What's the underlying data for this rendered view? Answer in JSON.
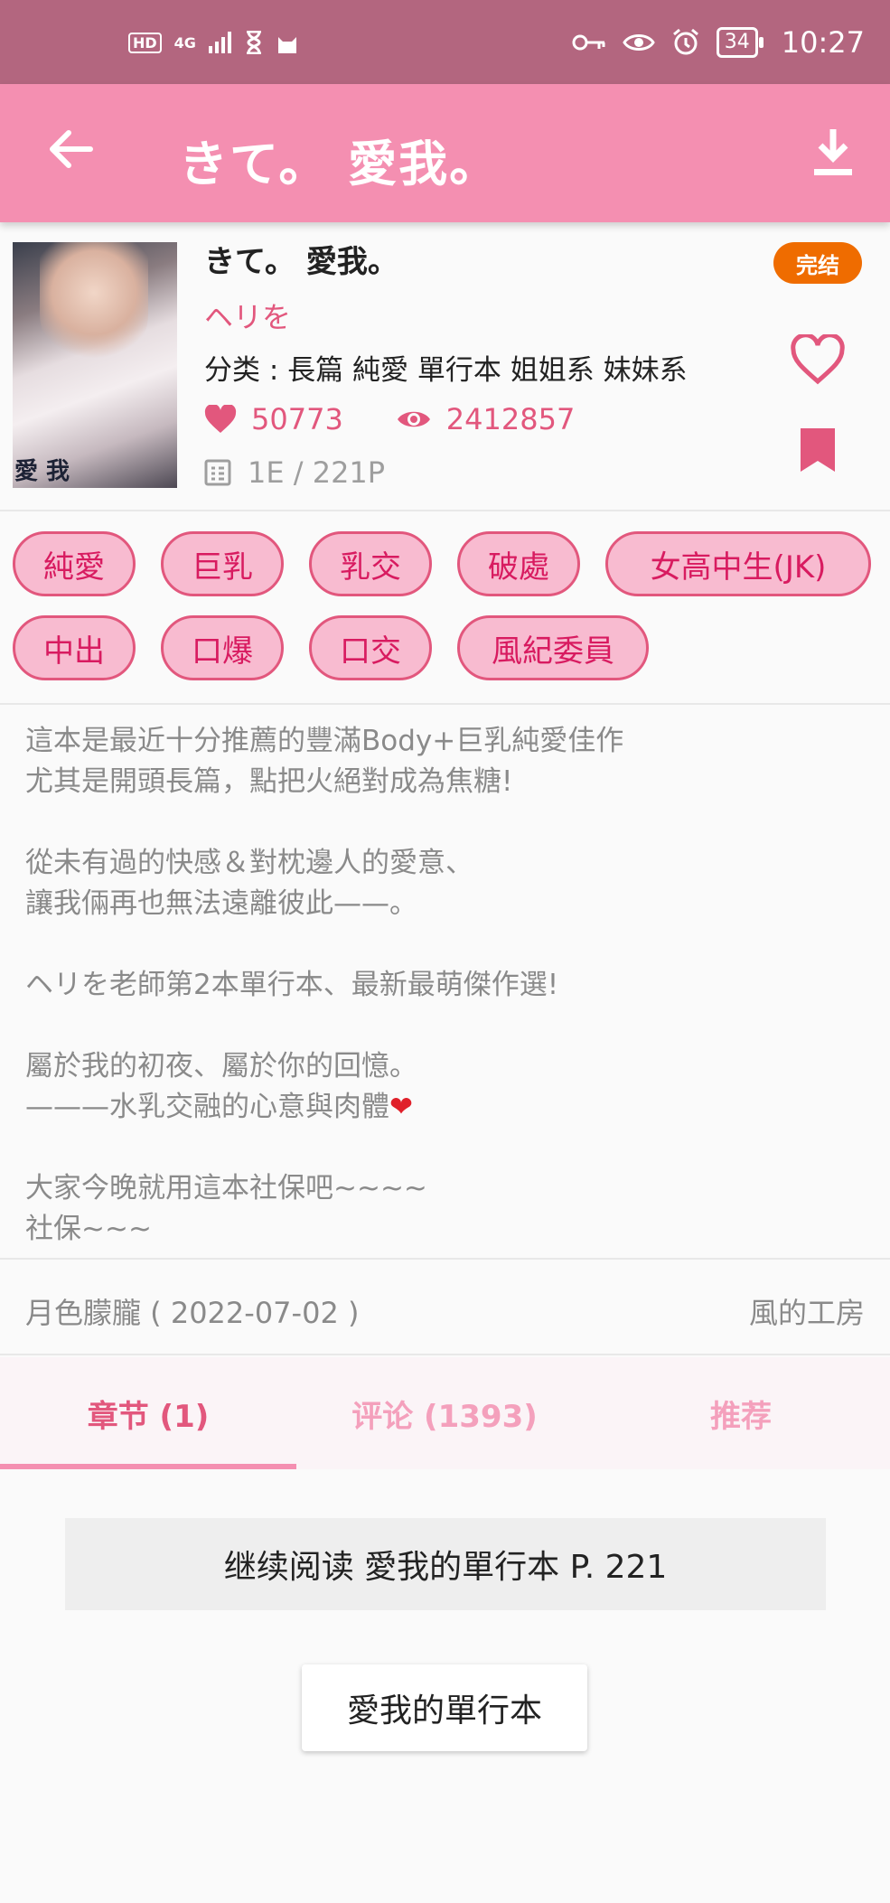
{
  "status_bar": {
    "network": "4G",
    "battery": "34",
    "time": "10:27"
  },
  "app_bar": {
    "title": "きて。 愛我。"
  },
  "comic": {
    "cover_text": "愛 我",
    "title": "きて。 愛我。",
    "status_badge": "完结",
    "author": "ヘリを",
    "category": "分类 : 長篇 純愛 單行本 姐姐系 妹妹系",
    "likes": "50773",
    "views": "2412857",
    "pages": "1E / 221P"
  },
  "tags": [
    "純愛",
    "巨乳",
    "乳交",
    "破處",
    "女高中生(JK)",
    "中出",
    "口爆",
    "口交",
    "風紀委員"
  ],
  "description": "這本是最近十分推薦的豐滿Body+巨乳純愛佳作\n尤其是開頭長篇，點把火絕對成為焦糖!\n\n從未有過的快感＆對枕邊人的愛意、\n讓我倆再也無法遠離彼此——。\n\nヘリを老師第2本單行本、最新最萌傑作選!\n\n屬於我的初夜、屬於你的回憶。\n———水乳交融的心意與肉體",
  "description_heart": "❤",
  "description_tail": "大家今晚就用這本社保吧~~~~\n社保~~~",
  "meta": {
    "uploader_date": "月色朦朧 ( 2022-07-02 )",
    "group": "風的工房"
  },
  "tabs": [
    {
      "label": "章节 (1)",
      "active": true
    },
    {
      "label": "评论 (1393)",
      "active": false
    },
    {
      "label": "推荐",
      "active": false
    }
  ],
  "continue_reading": "继续阅读 愛我的單行本 P. 221",
  "chapter_button": "愛我的單行本",
  "colors": {
    "status_bar": "#b3667f",
    "app_bar": "#f48fb1",
    "accent": "#e2577d",
    "badge": "#ef6c00",
    "tag_fill": "#f8bbd0"
  }
}
